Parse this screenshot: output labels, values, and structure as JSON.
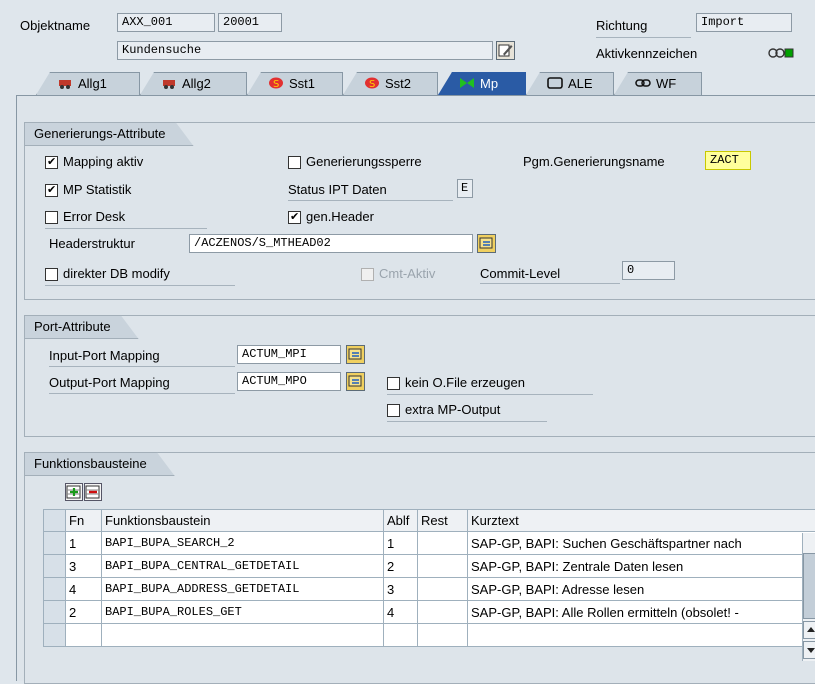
{
  "header": {
    "objektname_label": "Objektname",
    "objektname_value": "AXX_001",
    "objektnummer": "20001",
    "beschreibung": "Kundensuche",
    "richtung_label": "Richtung",
    "richtung_value": "Import",
    "aktivkennzeichen_label": "Aktivkennzeichen"
  },
  "tabs": [
    {
      "label": "Allg1",
      "icon": "car-icon"
    },
    {
      "label": "Allg2",
      "icon": "car-icon"
    },
    {
      "label": "Sst1",
      "icon": "s-badge-icon"
    },
    {
      "label": "Sst2",
      "icon": "s-badge-icon"
    },
    {
      "label": "Mp",
      "icon": "bowtie-icon",
      "active": true
    },
    {
      "label": "ALE",
      "icon": "monitor-icon"
    },
    {
      "label": "WF",
      "icon": "chain-link-icon"
    }
  ],
  "gen": {
    "title": "Generierungs-Attribute",
    "mapping_aktiv": "Mapping aktiv",
    "mp_statistik": "MP Statistik",
    "error_desk": "Error Desk",
    "headerstruktur_label": "Headerstruktur",
    "headerstruktur_value": "/ACZENOS/S_MTHEAD02",
    "direkter_db": "direkter DB modify",
    "generierungssperre": "Generierungssperre",
    "status_ipt": "Status IPT Daten",
    "status_ipt_value": "E",
    "gen_header": "gen.Header",
    "cmt_aktiv": "Cmt-Aktiv",
    "pgm_label": "Pgm.Generierungsname",
    "pgm_value": "ZACT",
    "commit_label": "Commit-Level",
    "commit_value": "0"
  },
  "port": {
    "title": "Port-Attribute",
    "input_label": "Input-Port Mapping",
    "input_value": "ACTUM_MPI",
    "output_label": "Output-Port Mapping",
    "output_value": "ACTUM_MPO",
    "kein_ofile": "kein O.File erzeugen",
    "extra_mp": "extra MP-Output"
  },
  "fb": {
    "title": "Funktionsbausteine",
    "columns": [
      "Fn",
      "Funktionsbaustein",
      "Ablf",
      "Rest",
      "Kurztext"
    ],
    "rows": [
      {
        "fn": "1",
        "name": "BAPI_BUPA_SEARCH_2",
        "ablf": "1",
        "rest": "",
        "text": "SAP-GP, BAPI: Suchen Geschäftspartner nach"
      },
      {
        "fn": "3",
        "name": "BAPI_BUPA_CENTRAL_GETDETAIL",
        "ablf": "2",
        "rest": "",
        "text": "SAP-GP, BAPI: Zentrale Daten lesen"
      },
      {
        "fn": "4",
        "name": "BAPI_BUPA_ADDRESS_GETDETAIL",
        "ablf": "3",
        "rest": "",
        "text": "SAP-GP, BAPI: Adresse lesen"
      },
      {
        "fn": "2",
        "name": "BAPI_BUPA_ROLES_GET",
        "ablf": "4",
        "rest": "",
        "text": "SAP-GP, BAPI: Alle Rollen ermitteln (obsolet! -"
      }
    ]
  },
  "colors": {
    "active_tab": "#2a5ba5",
    "status_green": "#00a000",
    "highlight_yellow": "#ffff9c"
  }
}
